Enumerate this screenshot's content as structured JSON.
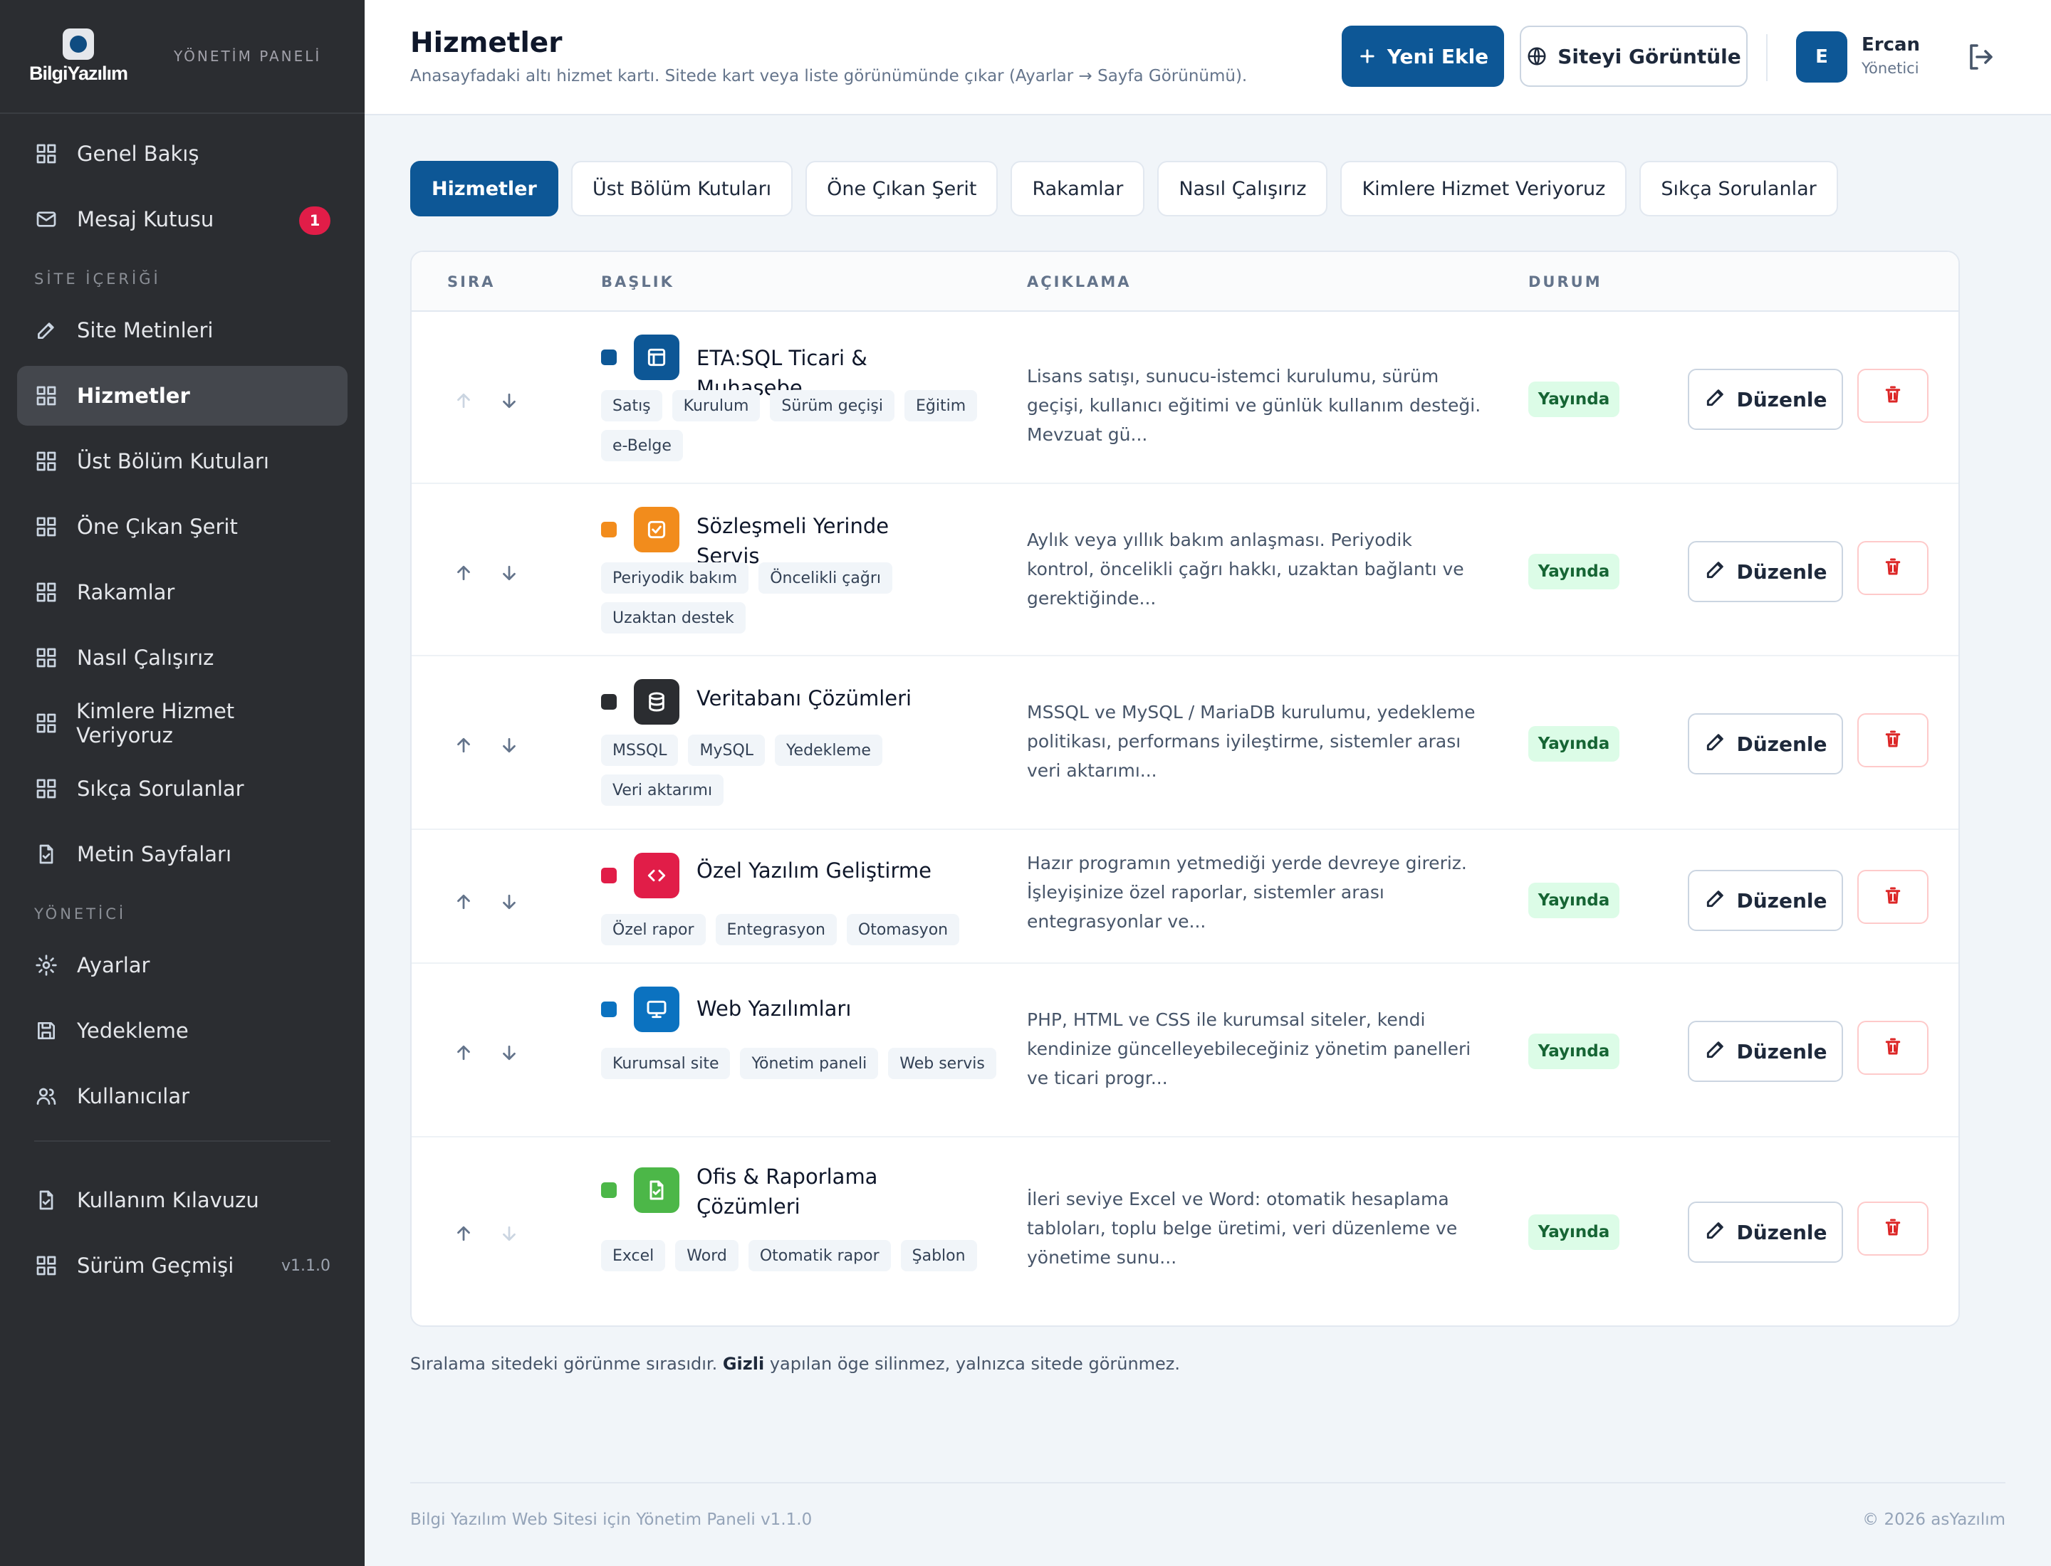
{
  "brand": {
    "logo_text": "BilgiYazılım",
    "panel_label": "YÖNETİM PANELİ"
  },
  "sidebar": {
    "top_items": [
      {
        "label": "Genel Bakış",
        "icon": "grid-icon"
      },
      {
        "label": "Mesaj Kutusu",
        "icon": "mail-icon",
        "badge": "1"
      }
    ],
    "section_content": "SİTE İÇERİĞİ",
    "content_items": [
      {
        "label": "Site Metinleri",
        "icon": "pencil-icon"
      },
      {
        "label": "Hizmetler",
        "icon": "grid-icon",
        "active": true
      },
      {
        "label": "Üst Bölüm Kutuları",
        "icon": "grid-icon"
      },
      {
        "label": "Öne Çıkan Şerit",
        "icon": "grid-icon"
      },
      {
        "label": "Rakamlar",
        "icon": "grid-icon"
      },
      {
        "label": "Nasıl Çalışırız",
        "icon": "grid-icon"
      },
      {
        "label": "Kimlere Hizmet Veriyoruz",
        "icon": "grid-icon"
      },
      {
        "label": "Sıkça Sorulanlar",
        "icon": "grid-icon"
      },
      {
        "label": "Metin Sayfaları",
        "icon": "file-check-icon"
      }
    ],
    "section_admin": "YÖNETİCİ",
    "admin_items": [
      {
        "label": "Ayarlar",
        "icon": "gear-icon"
      },
      {
        "label": "Yedekleme",
        "icon": "save-icon"
      },
      {
        "label": "Kullanıcılar",
        "icon": "users-icon"
      }
    ],
    "bottom_items": [
      {
        "label": "Kullanım Kılavuzu",
        "icon": "file-check-icon"
      },
      {
        "label": "Sürüm Geçmişi",
        "icon": "grid-icon",
        "version": "v1.1.0"
      }
    ]
  },
  "header": {
    "title": "Hizmetler",
    "subtitle": "Anasayfadaki altı hizmet kartı. Sitede kart veya liste görünümünde çıkar (Ayarlar → Sayfa Görünümü).",
    "new_button": "Yeni Ekle",
    "view_site_button": "Siteyi Görüntüle",
    "user_initial": "E",
    "user_name": "Ercan",
    "user_role": "Yönetici"
  },
  "tabs": [
    "Hizmetler",
    "Üst Bölüm Kutuları",
    "Öne Çıkan Şerit",
    "Rakamlar",
    "Nasıl Çalışırız",
    "Kimlere Hizmet Veriyoruz",
    "Sıkça Sorulanlar"
  ],
  "table": {
    "headers": {
      "order": "SIRA",
      "title": "BAŞLIK",
      "desc": "AÇIKLAMA",
      "status": "DURUM"
    },
    "edit_label": "Düzenle",
    "rows": [
      {
        "title": "ETA:SQL Ticari & Muhasebe",
        "color": "#0d5796",
        "icon": "layout-icon",
        "tags": [
          "Satış",
          "Kurulum",
          "Sürüm geçişi",
          "Eğitim",
          "e-Belge"
        ],
        "desc": "Lisans satışı, sunucu-istemci kurulumu, sürüm geçişi, kullanıcı eğitimi ve günlük kullanım desteği. Mevzuat gü...",
        "status": "Yayında"
      },
      {
        "title": "Sözleşmeli Yerinde Servis",
        "color": "#f28c1c",
        "icon": "checkbox-icon",
        "tags": [
          "Periyodik bakım",
          "Öncelikli çağrı",
          "Uzaktan destek"
        ],
        "desc": "Aylık veya yıllık bakım anlaşması. Periyodik kontrol, öncelikli çağrı hakkı, uzaktan bağlantı ve gerektiğinde...",
        "status": "Yayında"
      },
      {
        "title": "Veritabanı Çözümleri",
        "color": "#2b2d31",
        "icon": "database-icon",
        "tags": [
          "MSSQL",
          "MySQL",
          "Yedekleme",
          "Veri aktarımı"
        ],
        "desc": "MSSQL ve MySQL / MariaDB kurulumu, yedekleme politikası, performans iyileştirme, sistemler arası veri aktarımı...",
        "status": "Yayında"
      },
      {
        "title": "Özel Yazılım Geliştirme",
        "color": "#e11d48",
        "icon": "code-icon",
        "tags": [
          "Özel rapor",
          "Entegrasyon",
          "Otomasyon"
        ],
        "desc": "Hazır programın yetmediği yerde devreye gireriz. İşleyişinize özel raporlar, sistemler arası entegrasyonlar ve...",
        "status": "Yayında"
      },
      {
        "title": "Web Yazılımları",
        "color": "#0b72c0",
        "icon": "monitor-icon",
        "tags": [
          "Kurumsal site",
          "Yönetim paneli",
          "Web servis"
        ],
        "desc": "PHP, HTML ve CSS ile kurumsal siteler, kendi kendinize güncelleyebileceğiniz yönetim panelleri ve ticari progr...",
        "status": "Yayında"
      },
      {
        "title": "Ofis & Raporlama Çözümleri",
        "color": "#4cb748",
        "icon": "file-check-icon",
        "tags": [
          "Excel",
          "Word",
          "Otomatik rapor",
          "Şablon"
        ],
        "desc": "İleri seviye Excel ve Word: otomatik hesaplama tabloları, toplu belge üretimi, veri düzenleme ve yönetime sunu...",
        "status": "Yayında"
      }
    ]
  },
  "note": {
    "before": "Sıralama sitedeki görünme sırasıdır. ",
    "bold": "Gizli",
    "after": " yapılan öge silinmez, yalnızca sitede görünmez."
  },
  "footer": {
    "left": "Bilgi Yazılım Web Sitesi için Yönetim Paneli v1.1.0",
    "right": "© 2026 asYazılım"
  }
}
